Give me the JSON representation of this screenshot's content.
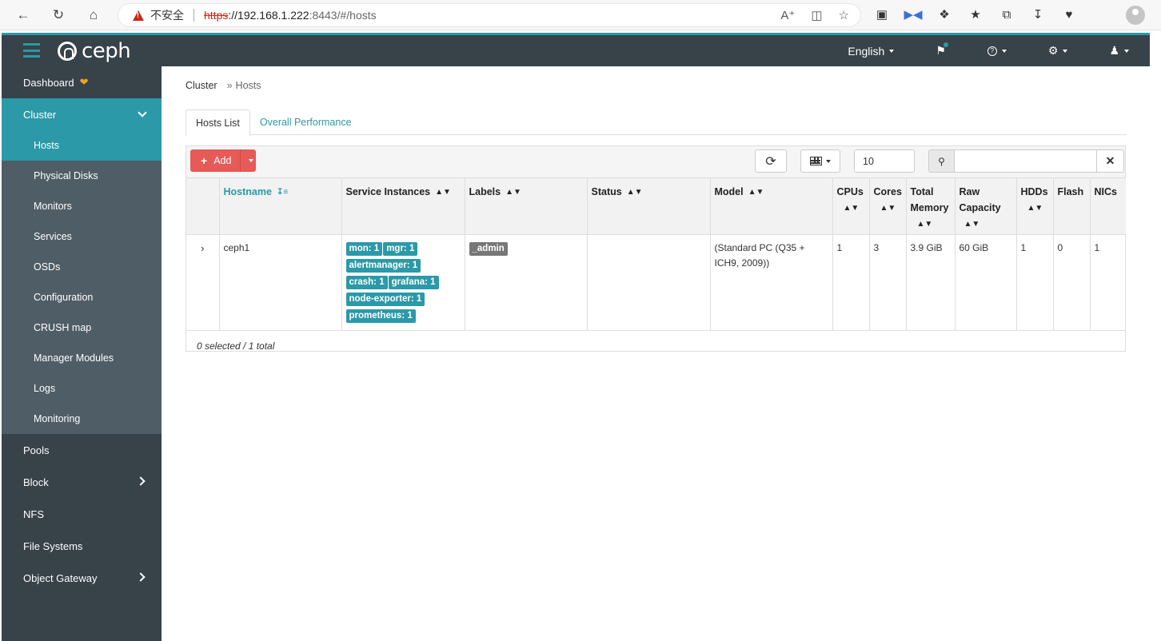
{
  "browser": {
    "insecure_label": "不安全",
    "url_scheme": "https",
    "url_host": "://192.168.1.222",
    "url_rest": ":8443/#/hosts"
  },
  "navbar": {
    "logo_text": "ceph",
    "language": "English"
  },
  "sidebar": {
    "dashboard": "Dashboard",
    "cluster": "Cluster",
    "cluster_items": [
      "Hosts",
      "Physical Disks",
      "Monitors",
      "Services",
      "OSDs",
      "Configuration",
      "CRUSH map",
      "Manager Modules",
      "Logs",
      "Monitoring"
    ],
    "pools": "Pools",
    "block": "Block",
    "nfs": "NFS",
    "file_systems": "File Systems",
    "object_gateway": "Object Gateway"
  },
  "breadcrumb": {
    "root": "Cluster",
    "sep": "»",
    "current": "Hosts"
  },
  "tabs": [
    "Hosts List",
    "Overall Performance"
  ],
  "toolbar": {
    "add_label": "Add",
    "limit_value": "10",
    "search_placeholder": ""
  },
  "table": {
    "headers": [
      "Hostname",
      "Service Instances",
      "Labels",
      "Status",
      "Model",
      "CPUs",
      "Cores",
      "Total Memory",
      "Raw Capacity",
      "HDDs",
      "Flash",
      "NICs"
    ],
    "row": {
      "expander": "›",
      "hostname": "ceph1",
      "services": [
        "mon: 1",
        "mgr: 1",
        "alertmanager: 1",
        "crash: 1",
        "grafana: 1",
        "node-exporter: 1",
        "prometheus: 1"
      ],
      "labels": [
        "_admin"
      ],
      "status": "",
      "model": "(Standard PC (Q35 + ICH9, 2009))",
      "cpus": "1",
      "cores": "3",
      "total_memory": "3.9 GiB",
      "raw_capacity": "60 GiB",
      "hdds": "1",
      "flash": "0",
      "nics": "1"
    },
    "footer": "0 selected / 1 total"
  },
  "colors": {
    "accent": "#2b99a8",
    "nav_bg": "#374249",
    "add_btn": "#e65a57",
    "sub_bg": "#4f5d66"
  }
}
